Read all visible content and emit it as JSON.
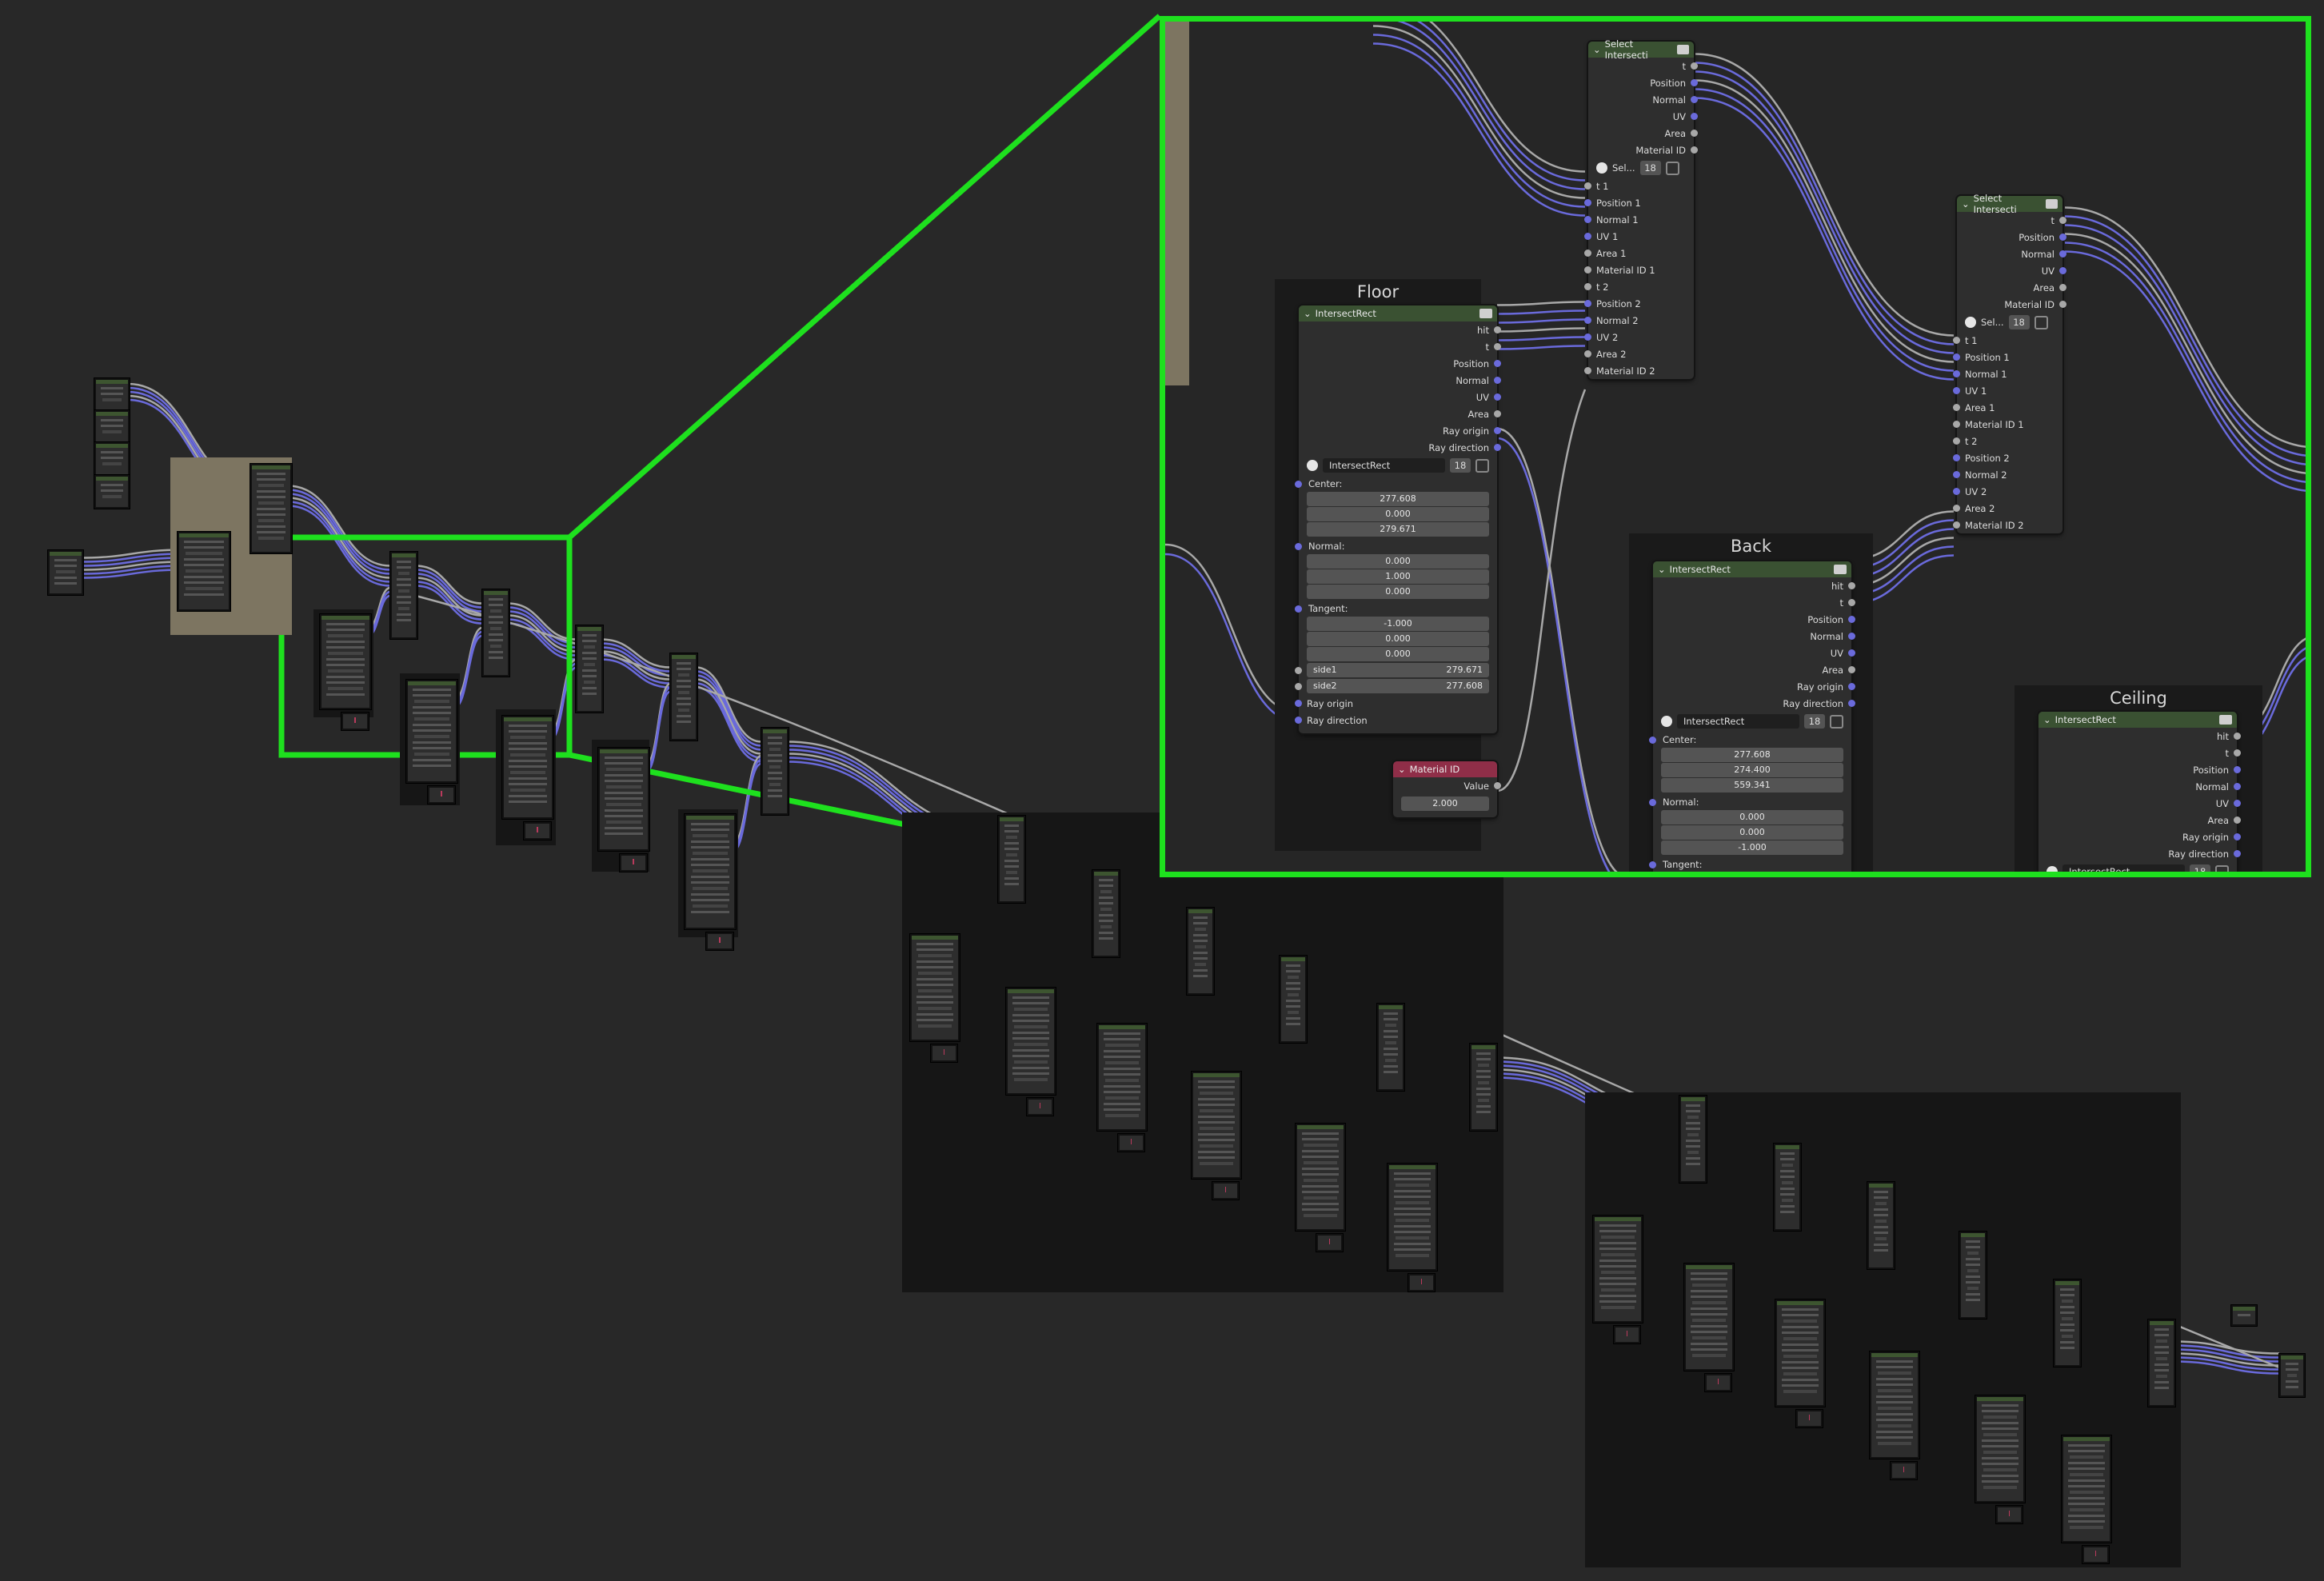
{
  "colors": {
    "zoom_border": "#1ee01e",
    "node_header": "#3a5132",
    "value_header": "#8f2e48",
    "link_grey": "#a8a8a8",
    "link_blue": "#6a6adb"
  },
  "zoom": {
    "floor_frame": "Floor",
    "back_frame": "Back",
    "ceiling_frame": "Ceiling",
    "select_a": {
      "title": "Select Intersecti",
      "outputs": [
        "t",
        "Position",
        "Normal",
        "UV",
        "Area",
        "Material ID"
      ],
      "datablock": "Sel...",
      "users": "18",
      "inputs": [
        "t 1",
        "Position 1",
        "Normal 1",
        "UV 1",
        "Area 1",
        "Material ID 1",
        "t 2",
        "Position 2",
        "Normal 2",
        "UV 2",
        "Area 2",
        "Material ID 2"
      ]
    },
    "select_b": {
      "title": "Select Intersecti",
      "outputs": [
        "t",
        "Position",
        "Normal",
        "UV",
        "Area",
        "Material ID"
      ],
      "datablock": "Sel...",
      "users": "18",
      "inputs": [
        "t 1",
        "Position 1",
        "Normal 1",
        "UV 1",
        "Area 1",
        "Material ID 1",
        "t 2",
        "Position 2",
        "Normal 2",
        "UV 2",
        "Area 2",
        "Material ID 2"
      ]
    },
    "floor_node": {
      "title": "IntersectRect",
      "outputs": [
        "hit",
        "t",
        "Position",
        "Normal",
        "UV",
        "Area",
        "Ray origin",
        "Ray direction"
      ],
      "datablock": "IntersectRect",
      "users": "18",
      "center_label": "Center:",
      "center": [
        "277.608",
        "0.000",
        "279.671"
      ],
      "normal_label": "Normal:",
      "normal": [
        "0.000",
        "1.000",
        "0.000"
      ],
      "tangent_label": "Tangent:",
      "tangent": [
        "-1.000",
        "0.000",
        "0.000"
      ],
      "side1_label": "side1",
      "side1": "279.671",
      "side2_label": "side2",
      "side2": "277.608",
      "in_ray_origin": "Ray origin",
      "in_ray_direction": "Ray direction"
    },
    "material_node": {
      "title": "Material ID",
      "output": "Value",
      "value": "2.000"
    },
    "back_node": {
      "title": "IntersectRect",
      "outputs": [
        "hit",
        "t",
        "Position",
        "Normal",
        "UV",
        "Area",
        "Ray origin",
        "Ray direction"
      ],
      "datablock": "IntersectRect",
      "users": "18",
      "center_label": "Center:",
      "center": [
        "277.608",
        "274.400",
        "559.341"
      ],
      "normal_label": "Normal:",
      "normal": [
        "0.000",
        "0.000",
        "-1.000"
      ],
      "tangent_label": "Tangent:"
    },
    "ceiling_node": {
      "title": "IntersectRect",
      "outputs": [
        "hit",
        "t",
        "Position",
        "Normal",
        "UV",
        "Area",
        "Ray origin",
        "Ray direction"
      ],
      "datablock": "IntersectRect",
      "users": "18"
    }
  }
}
